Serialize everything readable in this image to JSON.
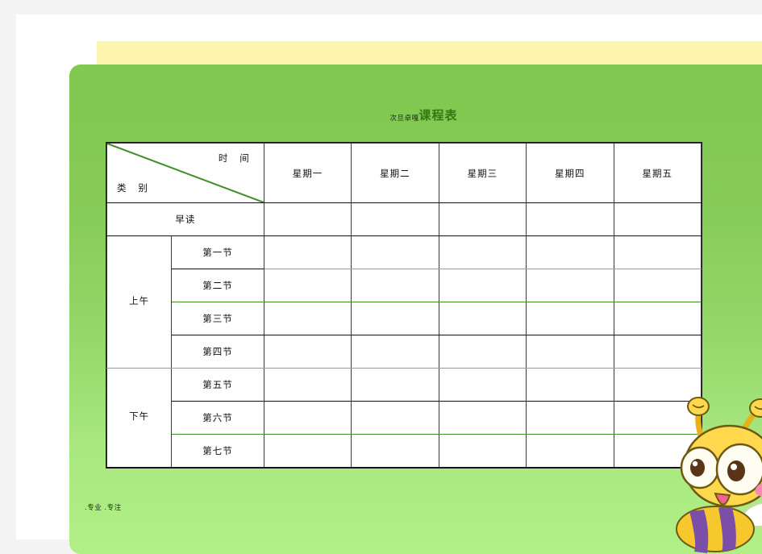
{
  "document": {
    "title_prefix": "次旦卓嘎",
    "title_main": "课程表",
    "slogan": ".专业  .专注"
  },
  "table": {
    "corner": {
      "time_label": "时 间",
      "category_label": "类 别"
    },
    "day_headers": [
      "星期一",
      "星期二",
      "星期三",
      "星期四",
      "星期五"
    ],
    "morning_read_label": "早读",
    "section_labels": {
      "morning": "上午",
      "afternoon": "下午"
    },
    "morning_periods": [
      "第一节",
      "第二节",
      "第三节",
      "第四节"
    ],
    "afternoon_periods": [
      "第五节",
      "第六节",
      "第七节"
    ],
    "cells": {
      "morning_read": [
        "",
        "",
        "",
        "",
        ""
      ],
      "p1": [
        "",
        "",
        "",
        "",
        ""
      ],
      "p2": [
        "",
        "",
        "",
        "",
        ""
      ],
      "p3": [
        "",
        "",
        "",
        "",
        ""
      ],
      "p4": [
        "",
        "",
        "",
        "",
        ""
      ],
      "p5": [
        "",
        "",
        "",
        "",
        ""
      ],
      "p6": [
        "",
        "",
        "",
        "",
        ""
      ],
      "p7": [
        "",
        "",
        "",
        "",
        ""
      ]
    }
  },
  "colors": {
    "panel_top": "#80c850",
    "panel_bottom": "#b0f086",
    "mat": "#fdf4b0",
    "title_accent": "#2f7a12",
    "diagonal": "#3f8f2a"
  }
}
